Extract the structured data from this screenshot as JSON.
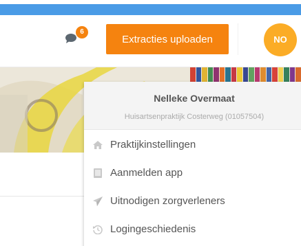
{
  "header": {
    "notification_count": "6",
    "upload_button_label": "Extracties uploaden",
    "avatar_initials": "NO"
  },
  "colors": {
    "blue_bar": "#4a9be6",
    "accent_orange": "#f5830f",
    "avatar_bg": "#fbac26"
  },
  "dropdown": {
    "user_name": "Nelleke Overmaat",
    "practice": "Huisartsenpraktijk Costerweg (01057504)",
    "items": [
      {
        "label": "Praktijkinstellingen",
        "icon": "home-icon"
      },
      {
        "label": "Aanmelden app",
        "icon": "tablet-icon"
      },
      {
        "label": "Uitnodigen zorgverleners",
        "icon": "send-icon"
      },
      {
        "label": "Logingeschiedenis",
        "icon": "history-icon"
      }
    ]
  }
}
